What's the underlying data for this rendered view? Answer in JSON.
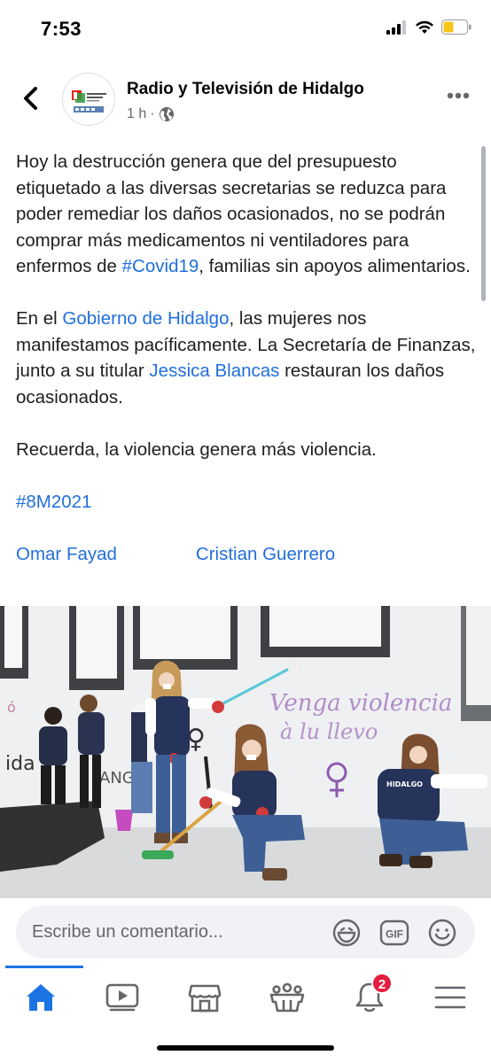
{
  "status_bar": {
    "time": "7:53"
  },
  "header": {
    "page_name": "Radio y Televisión de Hidalgo",
    "time_ago": "1 h",
    "separator": "·"
  },
  "post": {
    "p1_text": "Hoy la destrucción genera que del presupuesto etiquetado a las diversas secretarias se reduzca para poder remediar los daños ocasionados, no se podrán comprar más medicamentos ni ventiladores para enfermos de ",
    "p1_hashtag": "#Covid19",
    "p1_tail": ", familias sin apoyos alimentarios.",
    "p2_a": "En el ",
    "p2_link1": "Gobierno de Hidalgo",
    "p2_b": ", las mujeres nos manifestamos pacíficamente. La Secretaría de Finanzas, junto a su titular ",
    "p2_link2": "Jessica Blancas",
    "p2_c": " restauran los daños ocasionados.",
    "p3": "Recuerda, la violencia genera más violencia.",
    "hashtag": "#8M2021",
    "mention1": "Omar Fayad",
    "mention2": "Cristian Guerrero"
  },
  "comment_bar": {
    "placeholder": "Escribe un comentario..."
  },
  "tab_bar": {
    "notification_count": "2"
  },
  "colors": {
    "link": "#216fdb",
    "active_tab": "#1b74e4",
    "badge": "#e41e3f"
  },
  "icons": [
    "back-icon",
    "globe-icon",
    "more-icon",
    "sticker-icon",
    "gif-icon",
    "emoji-icon",
    "home-icon",
    "video-icon",
    "marketplace-icon",
    "groups-icon",
    "bell-icon",
    "menu-icon"
  ]
}
